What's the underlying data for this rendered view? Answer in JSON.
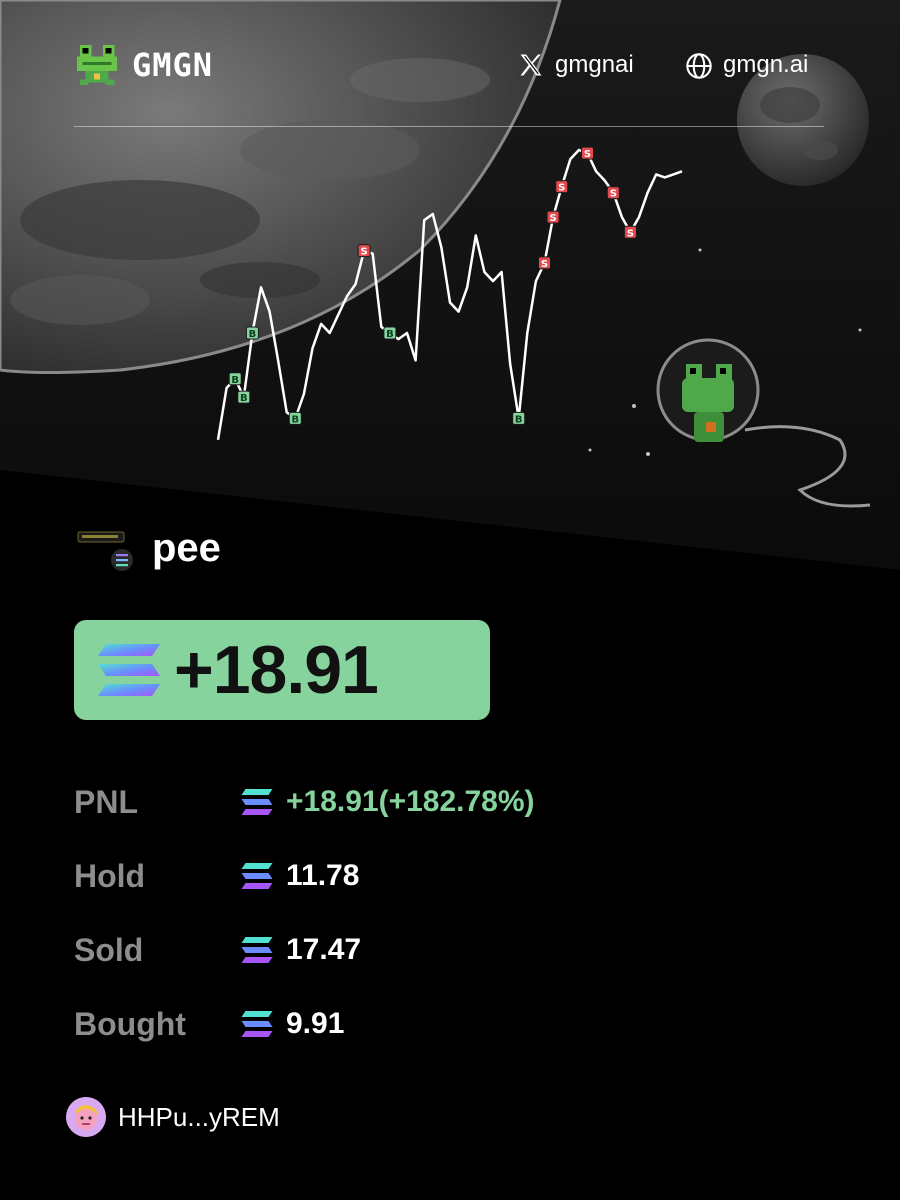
{
  "brand": {
    "name": "GMGN",
    "logo_icon": "frog-logo-icon"
  },
  "social": {
    "x_handle": "gmgnai",
    "website": "gmgn.ai"
  },
  "chart_data": {
    "type": "line",
    "title": "",
    "xlabel": "",
    "ylabel": "",
    "series": [
      {
        "values": [
          0.05,
          0.22,
          0.25,
          0.19,
          0.4,
          0.55,
          0.47,
          0.31,
          0.14,
          0.12,
          0.2,
          0.35,
          0.43,
          0.4,
          0.46,
          0.52,
          0.56,
          0.67,
          0.66,
          0.42,
          0.4,
          0.38,
          0.4,
          0.31,
          0.77,
          0.79,
          0.68,
          0.5,
          0.47,
          0.55,
          0.72,
          0.6,
          0.57,
          0.6,
          0.3,
          0.12,
          0.4,
          0.57,
          0.63,
          0.78,
          0.88,
          0.97,
          1.0,
          0.99,
          0.93,
          0.9,
          0.86,
          0.78,
          0.73,
          0.78,
          0.86,
          0.92,
          0.91,
          0.92,
          0.93
        ]
      }
    ],
    "markers": [
      {
        "label": "B",
        "index": 2,
        "color": "#86d39e"
      },
      {
        "label": "B",
        "index": 3,
        "color": "#86d39e"
      },
      {
        "label": "B",
        "index": 4,
        "color": "#86d39e"
      },
      {
        "label": "B",
        "index": 9,
        "color": "#86d39e"
      },
      {
        "label": "S",
        "index": 17,
        "color": "#e5484d"
      },
      {
        "label": "B",
        "index": 20,
        "color": "#86d39e"
      },
      {
        "label": "B",
        "index": 35,
        "color": "#86d39e"
      },
      {
        "label": "S",
        "index": 38,
        "color": "#e5484d"
      },
      {
        "label": "S",
        "index": 39,
        "color": "#e5484d"
      },
      {
        "label": "S",
        "index": 40,
        "color": "#e5484d"
      },
      {
        "label": "S",
        "index": 43,
        "color": "#e5484d"
      },
      {
        "label": "S",
        "index": 46,
        "color": "#e5484d"
      },
      {
        "label": "S",
        "index": 48,
        "color": "#e5484d"
      }
    ]
  },
  "token": {
    "symbol": "pee",
    "chain_icon": "solana-icon"
  },
  "pnl_badge": {
    "value": "+18.91",
    "color": "#86d39e"
  },
  "stats": [
    {
      "label": "PNL",
      "value": "+18.91(+182.78%)",
      "highlight": true
    },
    {
      "label": "Hold",
      "value": "11.78",
      "highlight": false
    },
    {
      "label": "Sold",
      "value": "17.47",
      "highlight": false
    },
    {
      "label": "Bought",
      "value": "9.91",
      "highlight": false
    }
  ],
  "wallet": {
    "address": "HHPu...yREM"
  },
  "colors": {
    "accent_green": "#86d39e",
    "sell_red": "#e5484d",
    "background": "#000000"
  }
}
